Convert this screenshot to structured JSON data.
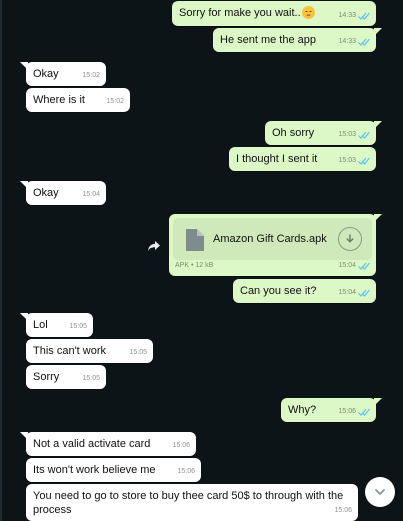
{
  "colors": {
    "background": "#0d1418",
    "incoming_bubble": "#ffffff",
    "outgoing_bubble": "#dcf8c6",
    "read_ticks": "#4fc3f7"
  },
  "messages": [
    {
      "text": "Sorry for make you wait..",
      "emoji": "pensive-face",
      "time": "14:33",
      "direction": "out",
      "status": "read"
    },
    {
      "text": "He sent me the app",
      "time": "14:33",
      "direction": "out",
      "status": "read"
    },
    {
      "text": "Okay",
      "time": "15:02",
      "direction": "in"
    },
    {
      "text": "Where is it",
      "time": "15:02",
      "direction": "in"
    },
    {
      "text": "Oh sorry",
      "time": "15:03",
      "direction": "out",
      "status": "read"
    },
    {
      "text": "I thought I sent it",
      "time": "15:03",
      "direction": "out",
      "status": "read"
    },
    {
      "text": "Okay",
      "time": "15:04",
      "direction": "in"
    },
    {
      "type": "file",
      "file_name": "Amazon Gift Cards.apk",
      "file_type": "APK",
      "file_size": "12 kB",
      "time": "15:04",
      "direction": "out",
      "status": "read"
    },
    {
      "text": "Can you see it?",
      "time": "15:04",
      "direction": "out",
      "status": "read"
    },
    {
      "text": "Lol",
      "time": "15:05",
      "direction": "in"
    },
    {
      "text": "This can't work",
      "time": "15:05",
      "direction": "in"
    },
    {
      "text": "Sorry",
      "time": "15:05",
      "direction": "in"
    },
    {
      "text": "Why?",
      "time": "15:06",
      "direction": "out",
      "status": "read"
    },
    {
      "text": "Not a valid activate card",
      "time": "15:06",
      "direction": "in"
    },
    {
      "text": "Its won't work believe me",
      "time": "15:06",
      "direction": "in"
    },
    {
      "text": "You need to go to store to buy thee card 50$ to through with the process",
      "time": "15:06",
      "direction": "in"
    }
  ],
  "file_separator": "•",
  "icons": {
    "forward": "forward-icon",
    "download": "download-icon",
    "scroll_down": "chevron-down-icon",
    "ticks": "double-check-icon",
    "file": "document-icon"
  }
}
